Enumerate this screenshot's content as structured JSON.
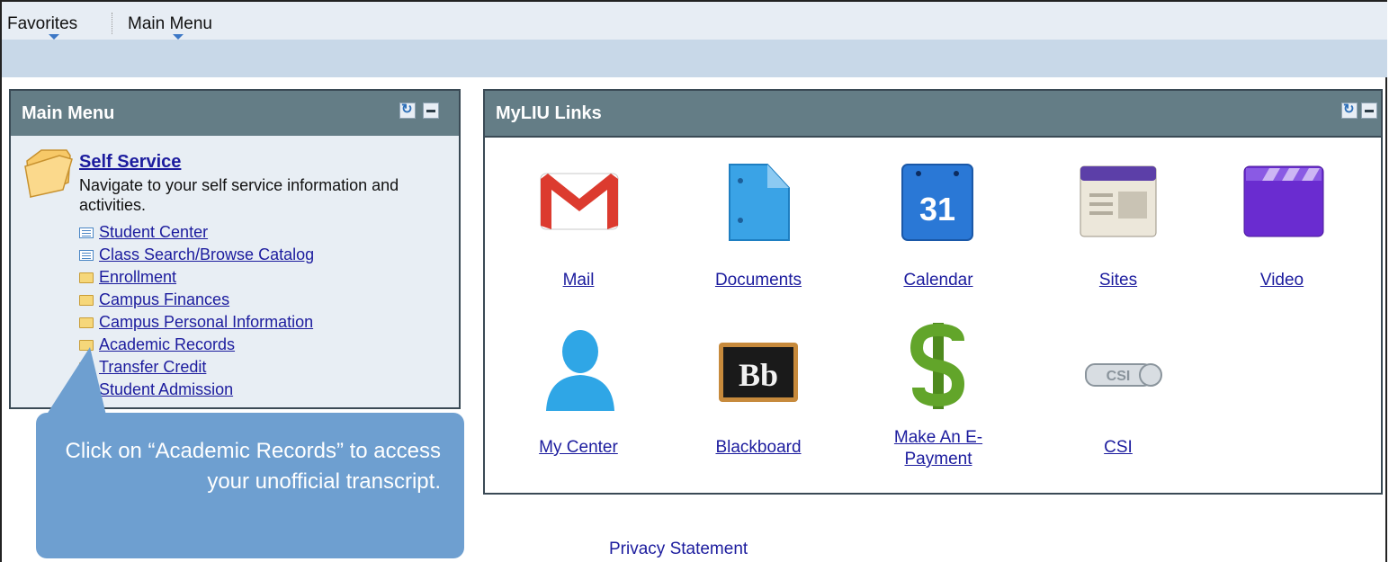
{
  "menubar": {
    "favorites": "Favorites",
    "main_menu": "Main Menu"
  },
  "main_menu_pagelet": {
    "title": "Main Menu",
    "self_service": {
      "title": "Self Service",
      "description": "Navigate to your self service information and activities."
    },
    "links": [
      {
        "label": "Student Center",
        "icon": "list-icon"
      },
      {
        "label": "Class Search/Browse Catalog",
        "icon": "list-icon"
      },
      {
        "label": "Enrollment",
        "icon": "folder-icon"
      },
      {
        "label": "Campus Finances",
        "icon": "folder-icon"
      },
      {
        "label": "Campus Personal Information",
        "icon": "folder-icon"
      },
      {
        "label": "Academic Records",
        "icon": "folder-icon"
      },
      {
        "label": "Transfer Credit",
        "icon": "folder-icon"
      },
      {
        "label": "Student Admission",
        "icon": "folder-icon"
      }
    ]
  },
  "myliu_pagelet": {
    "title": "MyLIU Links",
    "tiles": [
      {
        "label": "Mail",
        "icon": "gmail-icon"
      },
      {
        "label": "Documents",
        "icon": "documents-icon"
      },
      {
        "label": "Calendar",
        "icon": "calendar-icon",
        "calendar_day": "31"
      },
      {
        "label": "Sites",
        "icon": "sites-icon"
      },
      {
        "label": "Video",
        "icon": "video-icon"
      },
      {
        "label": "My Center",
        "icon": "person-icon"
      },
      {
        "label": "Blackboard",
        "icon": "blackboard-icon",
        "logo_text": "Bb"
      },
      {
        "label": "Make An E-Payment",
        "label_line1": "Make An E-",
        "label_line2": "Payment",
        "icon": "dollar-icon"
      },
      {
        "label": "CSI",
        "icon": "csi-icon",
        "logo_text": "CSI"
      }
    ]
  },
  "callout": {
    "text": "Click on “Academic Records” to access your unofficial transcript."
  },
  "footer": {
    "privacy": "Privacy Statement"
  },
  "colors": {
    "pagelet_header": "#647d86",
    "link": "#1c1c9e",
    "callout": "#6e9fd0"
  }
}
